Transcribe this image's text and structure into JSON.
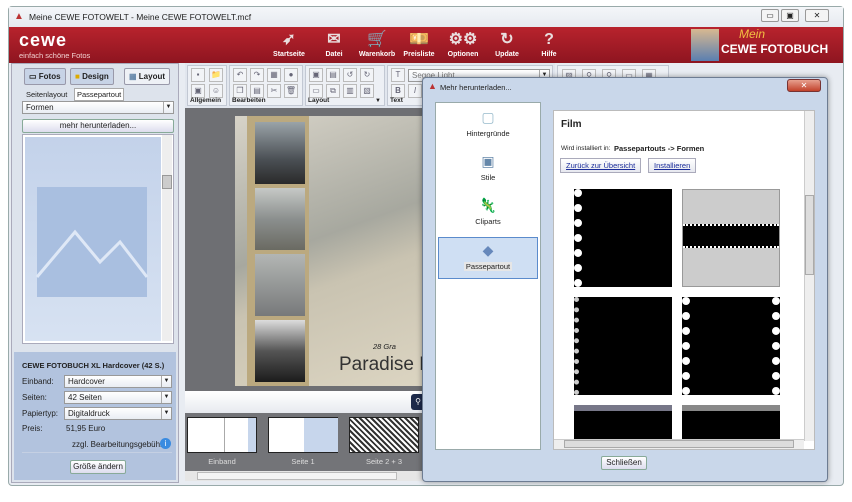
{
  "window": {
    "title": "Meine CEWE FOTOWELT - Meine CEWE FOTOWELT.mcf",
    "minimize": "▭",
    "maximize": "▣",
    "close": "✕"
  },
  "header": {
    "logo": "cewe",
    "tagline": "einfach schöne Fotos",
    "brand_top": "Mein",
    "brand_bottom": "CEWE FOTOBUCH",
    "nav": [
      {
        "label": "Startseite",
        "icon": "➶"
      },
      {
        "label": "Datei",
        "icon": "✉"
      },
      {
        "label": "Warenkorb",
        "icon": "🛒"
      },
      {
        "label": "Preisliste",
        "icon": "💴"
      },
      {
        "label": "Optionen",
        "icon": "⚙⚙"
      },
      {
        "label": "Update",
        "icon": "↻"
      },
      {
        "label": "Hilfe",
        "icon": "?"
      }
    ]
  },
  "left": {
    "tabs": [
      "Fotos",
      "Design",
      "Layout"
    ],
    "subtabs": [
      "Seitenlayout",
      "Passepartout"
    ],
    "category": "Formen",
    "more_button": "mehr herunterladen...",
    "product": {
      "title": "CEWE FOTOBUCH XL Hardcover (42 S.)",
      "fields": [
        {
          "label": "Einband:",
          "value": "Hardcover"
        },
        {
          "label": "Seiten:",
          "value": "42 Seiten"
        },
        {
          "label": "Papiertyp:",
          "value": "Digitaldruck"
        }
      ],
      "price_label": "Preis:",
      "price": "51,95 Euro",
      "fee": "zzgl. Bearbeitungsgebühr",
      "resize_button": "Größe ändern"
    }
  },
  "toolbar": {
    "groups": [
      "Allgemein",
      "Bearbeiten",
      "Layout",
      "Text"
    ],
    "font": "Segoe Light",
    "bold": "B",
    "italic": "I"
  },
  "canvas": {
    "subtitle": "28 Gra",
    "title": "Paradise B"
  },
  "thumbnails": [
    "Einband",
    "Seite 1",
    "Seite 2 + 3"
  ],
  "dialog": {
    "title": "Mehr herunterladen...",
    "categories": [
      "Hintergründe",
      "Stile",
      "Cliparts",
      "Passepartout"
    ],
    "selected": "Passepartout",
    "heading": "Film",
    "install_label": "Wird installiert in:",
    "install_path": "Passepartouts -> Formen",
    "back_button": "Zurück zur Übersicht",
    "install_button": "Installieren",
    "close_button": "Schließen"
  },
  "colors": {
    "brand_red": "#a81c26",
    "panel_blue": "#b2c3de"
  }
}
